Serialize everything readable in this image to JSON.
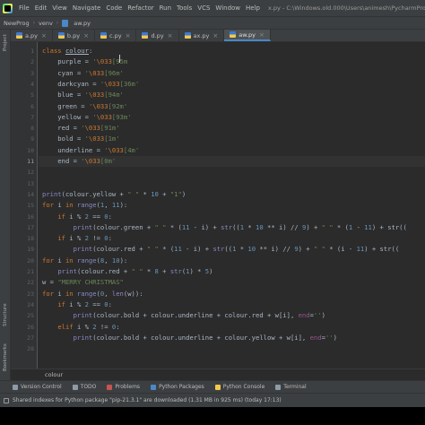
{
  "menubar": {
    "items": [
      "File",
      "Edit",
      "View",
      "Navigate",
      "Code",
      "Refactor",
      "Run",
      "Tools",
      "VCS",
      "Window",
      "Help"
    ],
    "title": "x.py - C:\\Windows.old.000\\Users\\animesh\\PycharmProjects\\NewProg\\venv"
  },
  "navbar": {
    "project": "NewProg",
    "folder": "venv",
    "file": "aw.py"
  },
  "left_strip": {
    "top": "Project",
    "middle": "Structure",
    "bottom": "Bookmarks"
  },
  "tabs": [
    {
      "label": "a.py",
      "active": false
    },
    {
      "label": "b.py",
      "active": false
    },
    {
      "label": "c.py",
      "active": false
    },
    {
      "label": "d.py",
      "active": false
    },
    {
      "label": "ax.py",
      "active": false
    },
    {
      "label": "aw.py",
      "active": true
    }
  ],
  "editor": {
    "current_line": 11,
    "lines": [
      {
        "n": 1,
        "tokens": [
          [
            "kw",
            "class "
          ],
          [
            "cls",
            "colour"
          ],
          [
            "plain",
            ":"
          ]
        ]
      },
      {
        "n": 2,
        "tokens": [
          [
            "plain",
            "    purple = "
          ],
          [
            "str",
            "'"
          ],
          [
            "esc",
            "\\033"
          ],
          [
            "str",
            "[95m"
          ]
        ]
      },
      {
        "n": 3,
        "tokens": [
          [
            "plain",
            "    cyan = "
          ],
          [
            "str",
            "'"
          ],
          [
            "esc",
            "\\033"
          ],
          [
            "str",
            "[96m'"
          ]
        ]
      },
      {
        "n": 4,
        "tokens": [
          [
            "plain",
            "    darkcyan = "
          ],
          [
            "str",
            "'"
          ],
          [
            "esc",
            "\\033"
          ],
          [
            "str",
            "[36m'"
          ]
        ]
      },
      {
        "n": 5,
        "tokens": [
          [
            "plain",
            "    blue = "
          ],
          [
            "str",
            "'"
          ],
          [
            "esc",
            "\\033"
          ],
          [
            "str",
            "[94m'"
          ]
        ]
      },
      {
        "n": 6,
        "tokens": [
          [
            "plain",
            "    green = "
          ],
          [
            "str",
            "'"
          ],
          [
            "esc",
            "\\033"
          ],
          [
            "str",
            "[92m'"
          ]
        ]
      },
      {
        "n": 7,
        "tokens": [
          [
            "plain",
            "    yellow = "
          ],
          [
            "str",
            "'"
          ],
          [
            "esc",
            "\\033"
          ],
          [
            "str",
            "[93m'"
          ]
        ]
      },
      {
        "n": 8,
        "tokens": [
          [
            "plain",
            "    red = "
          ],
          [
            "str",
            "'"
          ],
          [
            "esc",
            "\\033"
          ],
          [
            "str",
            "[91m'"
          ]
        ]
      },
      {
        "n": 9,
        "tokens": [
          [
            "plain",
            "    bold = "
          ],
          [
            "str",
            "'"
          ],
          [
            "esc",
            "\\033"
          ],
          [
            "str",
            "[1m'"
          ]
        ]
      },
      {
        "n": 10,
        "tokens": [
          [
            "plain",
            "    underline = "
          ],
          [
            "str",
            "'"
          ],
          [
            "esc",
            "\\033"
          ],
          [
            "str",
            "[4m'"
          ]
        ]
      },
      {
        "n": 11,
        "tokens": [
          [
            "plain",
            "    end = "
          ],
          [
            "str",
            "'"
          ],
          [
            "esc",
            "\\033"
          ],
          [
            "str",
            "[0m'"
          ]
        ]
      },
      {
        "n": 12,
        "tokens": []
      },
      {
        "n": 13,
        "tokens": []
      },
      {
        "n": 14,
        "tokens": [
          [
            "fn",
            "print"
          ],
          [
            "plain",
            "(colour.yellow + "
          ],
          [
            "str",
            "\" \""
          ],
          [
            "plain",
            " * "
          ],
          [
            "num",
            "10"
          ],
          [
            "plain",
            " + "
          ],
          [
            "str",
            "\"1\""
          ],
          [
            "plain",
            ")"
          ]
        ]
      },
      {
        "n": 15,
        "tokens": [
          [
            "kw",
            "for "
          ],
          [
            "plain",
            "i "
          ],
          [
            "kw",
            "in "
          ],
          [
            "fn",
            "range"
          ],
          [
            "plain",
            "("
          ],
          [
            "num",
            "1"
          ],
          [
            "plain",
            ", "
          ],
          [
            "num",
            "11"
          ],
          [
            "plain",
            "):"
          ]
        ]
      },
      {
        "n": 16,
        "tokens": [
          [
            "plain",
            "    "
          ],
          [
            "kw",
            "if "
          ],
          [
            "plain",
            "i % "
          ],
          [
            "num",
            "2"
          ],
          [
            "plain",
            " == "
          ],
          [
            "num",
            "0"
          ],
          [
            "plain",
            ":"
          ]
        ]
      },
      {
        "n": 17,
        "tokens": [
          [
            "plain",
            "        "
          ],
          [
            "fn",
            "print"
          ],
          [
            "plain",
            "(colour.green + "
          ],
          [
            "str",
            "\" \""
          ],
          [
            "plain",
            " * ("
          ],
          [
            "num",
            "11"
          ],
          [
            "plain",
            " - i) + "
          ],
          [
            "fn",
            "str"
          ],
          [
            "plain",
            "(("
          ],
          [
            "num",
            "1"
          ],
          [
            "plain",
            " * "
          ],
          [
            "num",
            "10"
          ],
          [
            "plain",
            " ** i) // "
          ],
          [
            "num",
            "9"
          ],
          [
            "plain",
            ") + "
          ],
          [
            "str",
            "\" \""
          ],
          [
            "plain",
            " * ("
          ],
          [
            "num",
            "1"
          ],
          [
            "plain",
            " - "
          ],
          [
            "num",
            "11"
          ],
          [
            "plain",
            ") + str(("
          ]
        ]
      },
      {
        "n": 18,
        "tokens": [
          [
            "plain",
            "    "
          ],
          [
            "kw",
            "if "
          ],
          [
            "plain",
            "i % "
          ],
          [
            "num",
            "2"
          ],
          [
            "plain",
            " != "
          ],
          [
            "num",
            "0"
          ],
          [
            "plain",
            ":"
          ]
        ]
      },
      {
        "n": 19,
        "tokens": [
          [
            "plain",
            "        "
          ],
          [
            "fn",
            "print"
          ],
          [
            "plain",
            "(colour.red + "
          ],
          [
            "str",
            "\" \""
          ],
          [
            "plain",
            " * ("
          ],
          [
            "num",
            "11"
          ],
          [
            "plain",
            " - i) + "
          ],
          [
            "fn",
            "str"
          ],
          [
            "plain",
            "(("
          ],
          [
            "num",
            "1"
          ],
          [
            "plain",
            " * "
          ],
          [
            "num",
            "10"
          ],
          [
            "plain",
            " ** i) // "
          ],
          [
            "num",
            "9"
          ],
          [
            "plain",
            ") + "
          ],
          [
            "str",
            "\" \""
          ],
          [
            "plain",
            " * (i - "
          ],
          [
            "num",
            "11"
          ],
          [
            "plain",
            ") + str(("
          ]
        ]
      },
      {
        "n": 20,
        "tokens": [
          [
            "kw",
            "for "
          ],
          [
            "plain",
            "i "
          ],
          [
            "kw",
            "in "
          ],
          [
            "fn",
            "range"
          ],
          [
            "plain",
            "("
          ],
          [
            "num",
            "8"
          ],
          [
            "plain",
            ", "
          ],
          [
            "num",
            "10"
          ],
          [
            "plain",
            "):"
          ]
        ]
      },
      {
        "n": 21,
        "tokens": [
          [
            "plain",
            "    "
          ],
          [
            "fn",
            "print"
          ],
          [
            "plain",
            "(colour.red + "
          ],
          [
            "str",
            "\" \""
          ],
          [
            "plain",
            " * "
          ],
          [
            "num",
            "8"
          ],
          [
            "plain",
            " + "
          ],
          [
            "fn",
            "str"
          ],
          [
            "plain",
            "("
          ],
          [
            "num",
            "1"
          ],
          [
            "plain",
            ") * "
          ],
          [
            "num",
            "5"
          ],
          [
            "plain",
            ")"
          ]
        ]
      },
      {
        "n": 22,
        "tokens": [
          [
            "plain",
            "w = "
          ],
          [
            "str",
            "\"MERRY CHRISTMAS\""
          ]
        ]
      },
      {
        "n": 23,
        "tokens": [
          [
            "kw",
            "for "
          ],
          [
            "plain",
            "i "
          ],
          [
            "kw",
            "in "
          ],
          [
            "fn",
            "range"
          ],
          [
            "plain",
            "("
          ],
          [
            "num",
            "0"
          ],
          [
            "plain",
            ", "
          ],
          [
            "fn",
            "len"
          ],
          [
            "plain",
            "(w)):"
          ]
        ]
      },
      {
        "n": 24,
        "tokens": [
          [
            "plain",
            "    "
          ],
          [
            "kw",
            "if "
          ],
          [
            "plain",
            "i % "
          ],
          [
            "num",
            "2"
          ],
          [
            "plain",
            " == "
          ],
          [
            "num",
            "0"
          ],
          [
            "plain",
            ":"
          ]
        ]
      },
      {
        "n": 25,
        "tokens": [
          [
            "plain",
            "        "
          ],
          [
            "fn",
            "print"
          ],
          [
            "plain",
            "(colour.bold + colour.underline + colour.red + w[i], "
          ],
          [
            "mag",
            "end"
          ],
          [
            "plain",
            "="
          ],
          [
            "str",
            "''"
          ],
          [
            "plain",
            ")"
          ]
        ]
      },
      {
        "n": 26,
        "tokens": [
          [
            "plain",
            "    "
          ],
          [
            "kw",
            "elif "
          ],
          [
            "plain",
            "i % "
          ],
          [
            "num",
            "2"
          ],
          [
            "plain",
            " != "
          ],
          [
            "num",
            "0"
          ],
          [
            "plain",
            ":"
          ]
        ]
      },
      {
        "n": 27,
        "tokens": [
          [
            "plain",
            "        "
          ],
          [
            "fn",
            "print"
          ],
          [
            "plain",
            "(colour.bold + colour.underline + colour.yellow + w[i], "
          ],
          [
            "mag",
            "end"
          ],
          [
            "plain",
            "="
          ],
          [
            "str",
            "''"
          ],
          [
            "plain",
            ")"
          ]
        ]
      },
      {
        "n": 28,
        "tokens": []
      }
    ]
  },
  "crumbbar": {
    "text": "colour"
  },
  "toolwindows": [
    {
      "label": "Version Control",
      "color": "#8f9aa6"
    },
    {
      "label": "TODO",
      "color": "#8f9aa6"
    },
    {
      "label": "Problems",
      "color": "#c75450"
    },
    {
      "label": "Python Packages",
      "color": "#4a88c7"
    },
    {
      "label": "Python Console",
      "color": "#f2c94c"
    },
    {
      "label": "Terminal",
      "color": "#8f9aa6"
    }
  ],
  "statusbar": {
    "text": "Shared indexes for Python package \"pip-21.3.1\" are downloaded (1.31 MB in 925 ms) (today 17:13)"
  }
}
